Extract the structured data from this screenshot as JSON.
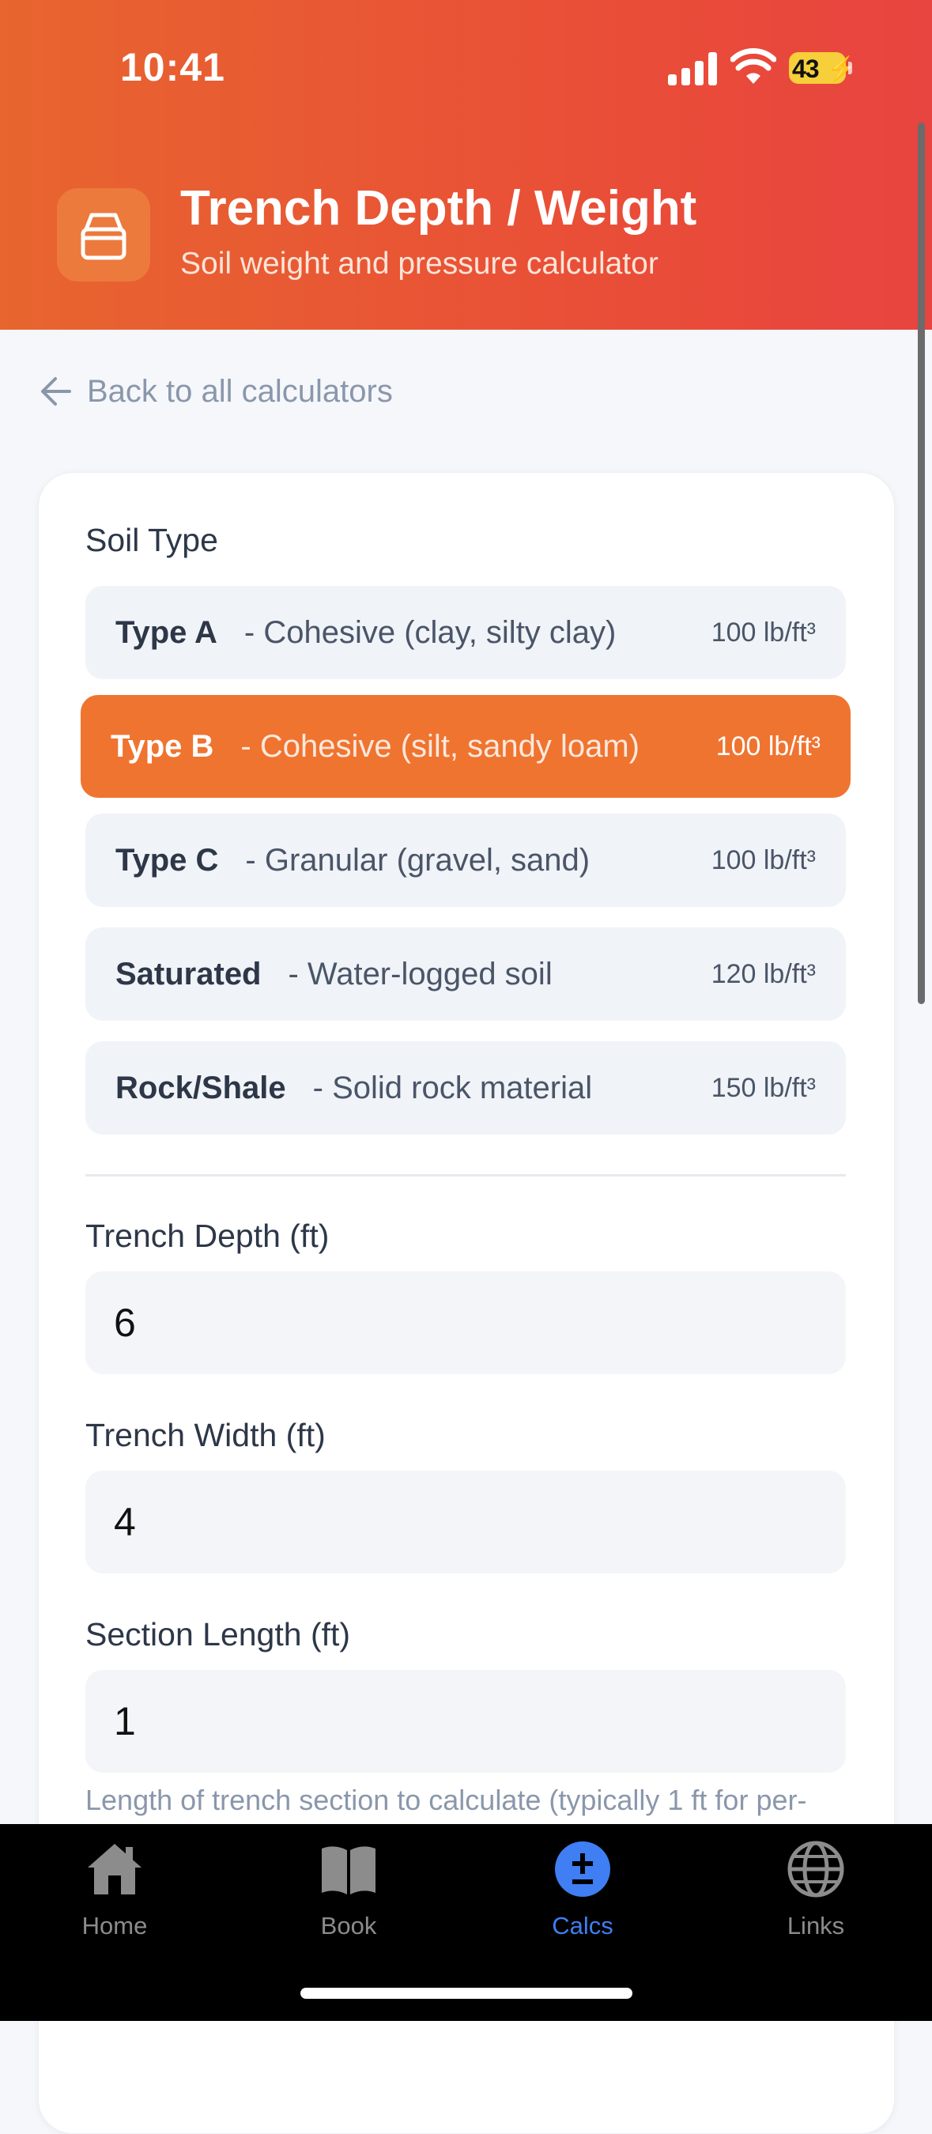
{
  "status_bar": {
    "time": "10:41",
    "battery": "43"
  },
  "header": {
    "title": "Trench Depth / Weight",
    "subtitle": "Soil weight and pressure calculator",
    "icon": "bucket-icon"
  },
  "back_link": {
    "label": "Back to all calculators"
  },
  "soil_type": {
    "label": "Soil Type",
    "options": [
      {
        "name": "Type A",
        "desc": "- Cohesive (clay, silty clay)",
        "weight": "100 lb/ft³",
        "selected": false
      },
      {
        "name": "Type B",
        "desc": "- Cohesive (silt, sandy loam)",
        "weight": "100 lb/ft³",
        "selected": true
      },
      {
        "name": "Type C",
        "desc": "- Granular (gravel, sand)",
        "weight": "100 lb/ft³",
        "selected": false
      },
      {
        "name": "Saturated",
        "desc": "- Water-logged soil",
        "weight": "120 lb/ft³",
        "selected": false
      },
      {
        "name": "Rock/Shale",
        "desc": "- Solid rock material",
        "weight": "150 lb/ft³",
        "selected": false
      }
    ]
  },
  "fields": {
    "depth": {
      "label": "Trench Depth (ft)",
      "value": "6"
    },
    "width": {
      "label": "Trench Width (ft)",
      "value": "4"
    },
    "length": {
      "label": "Section Length (ft)",
      "value": "1",
      "hint": "Length of trench section to calculate (typically 1 ft for per-"
    }
  },
  "tabbar": {
    "tabs": [
      {
        "label": "Home",
        "icon": "home-icon",
        "active": false
      },
      {
        "label": "Book",
        "icon": "book-icon",
        "active": false
      },
      {
        "label": "Calcs",
        "icon": "plus-minus-icon",
        "active": true
      },
      {
        "label": "Links",
        "icon": "globe-icon",
        "active": false
      }
    ]
  },
  "colors": {
    "header_start": "#e8652f",
    "header_end": "#e84440",
    "selected": "#ef7430",
    "active_tab": "#3f7ef3"
  }
}
